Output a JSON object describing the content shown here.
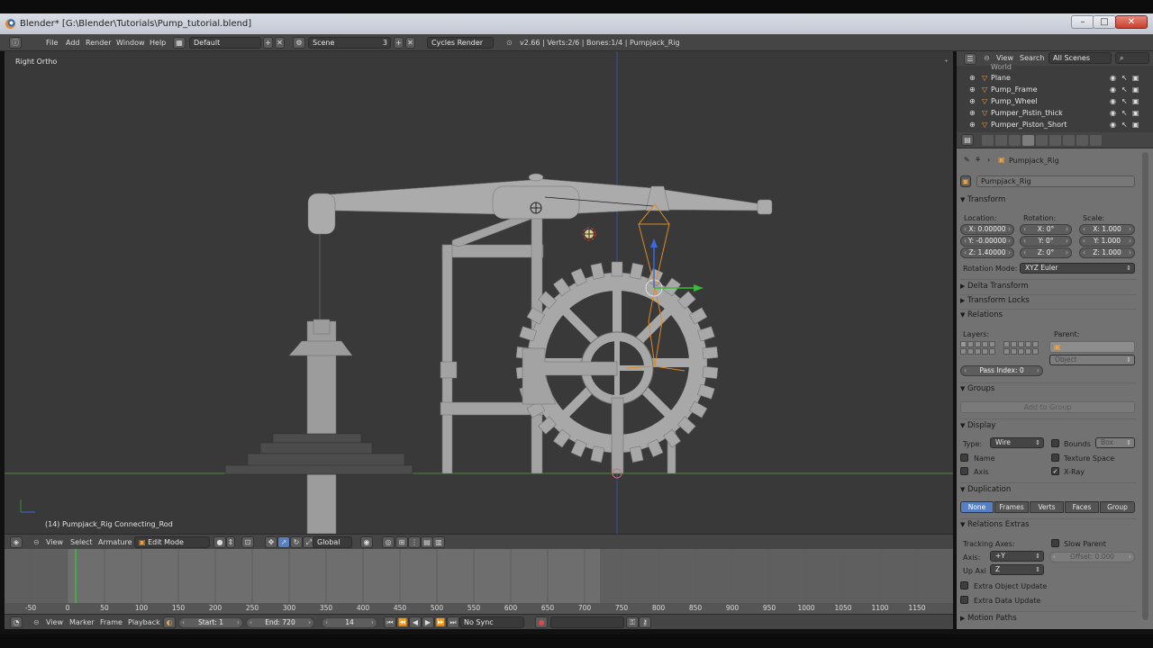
{
  "window": {
    "title": "Blender* [G:\\Blender\\Tutorials\\Pump_tutorial.blend]",
    "minimize": "–",
    "maximize": "□",
    "close": "✕"
  },
  "info_header": {
    "menus": [
      "File",
      "Add",
      "Render",
      "Window",
      "Help"
    ],
    "screen_layout": "Default",
    "scene": "Scene",
    "scene_count": "3",
    "render_engine": "Cycles Render",
    "stats": "v2.66 | Verts:2/6 | Bones:1/4 | Pumpjack_Rig"
  },
  "viewport": {
    "view_label": "Right Ortho",
    "object_label": "(14) Pumpjack_Rig Connecting_Rod"
  },
  "view3d_header": {
    "menus": [
      "View",
      "Select",
      "Armature"
    ],
    "mode": "Edit Mode",
    "orientation": "Global"
  },
  "timeline": {
    "ruler": [
      "-50",
      "0",
      "50",
      "100",
      "150",
      "200",
      "250",
      "300",
      "350",
      "400",
      "450",
      "500",
      "550",
      "600",
      "650",
      "700",
      "750",
      "800",
      "850",
      "900",
      "950",
      "1000",
      "1050",
      "1100",
      "1150"
    ],
    "menus": [
      "View",
      "Marker",
      "Frame",
      "Playback"
    ],
    "start": "Start: 1",
    "end": "End: 720",
    "current": "14",
    "sync": "No Sync"
  },
  "outliner": {
    "menus": [
      "View",
      "Search"
    ],
    "filter": "All Scenes",
    "items": [
      "World",
      "Plane",
      "Pump_Frame",
      "Pump_Wheel",
      "Pumper_Pistin_thick",
      "Pumper_Piston_Short"
    ]
  },
  "properties": {
    "breadcrumb": "Pumpjack_Rig",
    "object_name": "Pumpjack_Rig",
    "transform": {
      "title": "Transform",
      "location_label": "Location:",
      "rotation_label": "Rotation:",
      "scale_label": "Scale:",
      "location": [
        "X: 0.00000",
        "Y: -0.00000",
        "Z: 1.40000"
      ],
      "rotation": [
        "X: 0°",
        "Y: 0°",
        "Z: 0°"
      ],
      "scale": [
        "X: 1.000",
        "Y: 1.000",
        "Z: 1.000"
      ],
      "rotation_mode_label": "Rotation Mode:",
      "rotation_mode": "XYZ Euler"
    },
    "panels": [
      "Delta Transform",
      "Transform Locks",
      "Relations"
    ],
    "relations": {
      "layers_label": "Layers:",
      "parent_label": "Parent:",
      "parent_type": "Object",
      "pass_index": "Pass Index: 0"
    },
    "groups": {
      "title": "Groups",
      "add": "Add to Group"
    },
    "display": {
      "title": "Display",
      "type_label": "Type:",
      "type": "Wire",
      "bounds": "Bounds",
      "bounds_type": "Box",
      "name": "Name",
      "texture_space": "Texture Space",
      "axis": "Axis",
      "xray": "X-Ray"
    },
    "duplication": {
      "title": "Duplication",
      "options": [
        "None",
        "Frames",
        "Verts",
        "Faces",
        "Group"
      ]
    },
    "relations_extras": {
      "title": "Relations Extras",
      "tracking_axes": "Tracking Axes:",
      "slow_parent": "Slow Parent",
      "axis_label": "Axis:",
      "axis": "+Y",
      "offset": "Offset: 0.000",
      "up_axis_label": "Up Axi",
      "up_axis": "Z",
      "extra_object_update": "Extra Object Update",
      "extra_data_update": "Extra Data Update"
    },
    "motion_paths": "Motion Paths"
  }
}
